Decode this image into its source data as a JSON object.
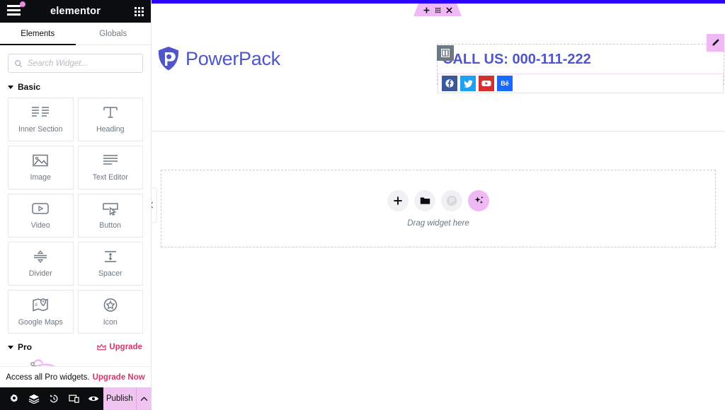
{
  "panel": {
    "brand": "elementor",
    "menu_icon": "hamburger-icon",
    "apps_icon": "apps-grid-icon",
    "tabs": [
      {
        "label": "Elements",
        "active": true
      },
      {
        "label": "Globals",
        "active": false
      }
    ],
    "search": {
      "placeholder": "Search Widget...",
      "value": "",
      "icon": "search-icon"
    },
    "categories": [
      {
        "title": "Basic",
        "widgets": [
          {
            "label": "Inner Section",
            "icon": "columns-icon"
          },
          {
            "label": "Heading",
            "icon": "heading-t-icon"
          },
          {
            "label": "Image",
            "icon": "image-icon"
          },
          {
            "label": "Text Editor",
            "icon": "text-lines-icon"
          },
          {
            "label": "Video",
            "icon": "video-play-icon"
          },
          {
            "label": "Button",
            "icon": "button-cursor-icon"
          },
          {
            "label": "Divider",
            "icon": "divider-icon"
          },
          {
            "label": "Spacer",
            "icon": "spacer-arrows-icon"
          },
          {
            "label": "Google Maps",
            "icon": "google-maps-icon"
          },
          {
            "label": "Icon",
            "icon": "star-badge-icon"
          }
        ]
      },
      {
        "title": "Pro",
        "upgrade_label": "Upgrade",
        "upgrade_icon": "crown-icon"
      }
    ],
    "pro_banner": {
      "text": "Access all Pro widgets.",
      "link": "Upgrade Now"
    },
    "footer": {
      "tools": [
        {
          "icon": "gear-icon",
          "name": "settings"
        },
        {
          "icon": "layers-icon",
          "name": "navigator"
        },
        {
          "icon": "history-icon",
          "name": "history"
        },
        {
          "icon": "responsive-icon",
          "name": "responsive-mode"
        },
        {
          "icon": "eye-icon",
          "name": "preview"
        }
      ],
      "publish_label": "Publish",
      "publish_caret_icon": "chevron-up-icon"
    }
  },
  "canvas": {
    "section_handle": {
      "add_icon": "plus-icon",
      "drag_icon": "drag-dots-icon",
      "close_icon": "close-x-icon"
    },
    "logo": {
      "text": "PowerPack",
      "icon": "powerpack-logo-icon",
      "color": "#4e56c9"
    },
    "column": {
      "handle_icon": "column-handle-icon",
      "heading": "CALL US: 000-111-222",
      "heading_color": "#4e56c9",
      "edit_icon": "pencil-edit-icon",
      "social_icons": [
        {
          "name": "facebook-icon",
          "color": "#3b5998",
          "glyph": "f"
        },
        {
          "name": "twitter-icon",
          "color": "#1da1f2",
          "glyph": "t"
        },
        {
          "name": "youtube-icon",
          "color": "#d32f2f",
          "glyph": "y"
        },
        {
          "name": "behance-icon",
          "color": "#1769ff",
          "glyph": "Bē"
        }
      ]
    },
    "dropzone": {
      "label": "Drag widget here",
      "buttons": [
        {
          "name": "add-widget-button",
          "icon": "plus-icon"
        },
        {
          "name": "template-library-button",
          "icon": "folder-icon"
        },
        {
          "name": "powerpack-templates-button",
          "icon": "powerpack-circle-icon"
        },
        {
          "name": "ai-button",
          "icon": "sparkles-icon"
        }
      ]
    },
    "collapse_tab": {
      "icon": "chevron-left-icon"
    },
    "colors": {
      "top_rule": "#2b00ff",
      "handle": "#f0b8f5",
      "section_outline": "#f2d9f7",
      "dashed": "#c9ccd0"
    }
  }
}
